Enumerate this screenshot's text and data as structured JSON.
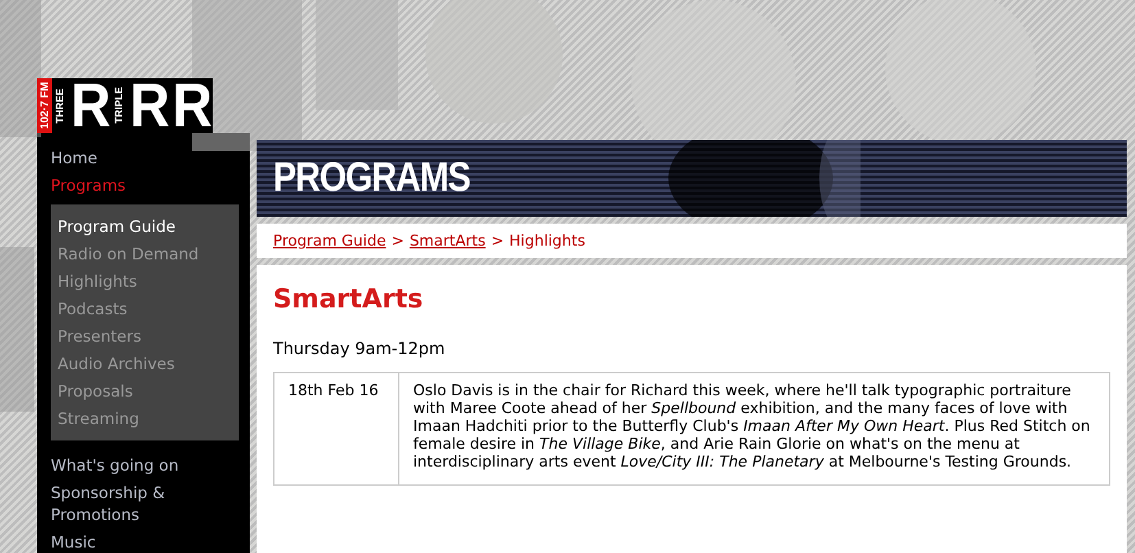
{
  "logo": {
    "frequency": "102·7 FM",
    "parts": [
      {
        "kind": "vertical",
        "text": "THREE"
      },
      {
        "kind": "letter",
        "text": "R"
      },
      {
        "kind": "vertical",
        "text": "TRIPLE"
      },
      {
        "kind": "letter",
        "text": "R"
      },
      {
        "kind": "letter",
        "text": "R"
      }
    ]
  },
  "nav": {
    "items": [
      {
        "label": "Home",
        "selected": false
      },
      {
        "label": "Programs",
        "selected": true,
        "children": [
          {
            "label": "Program Guide",
            "selected": true
          },
          {
            "label": "Radio on Demand",
            "selected": false
          },
          {
            "label": "Highlights",
            "selected": false
          },
          {
            "label": "Podcasts",
            "selected": false
          },
          {
            "label": "Presenters",
            "selected": false
          },
          {
            "label": "Audio Archives",
            "selected": false
          },
          {
            "label": "Proposals",
            "selected": false
          },
          {
            "label": "Streaming",
            "selected": false
          }
        ]
      },
      {
        "label": "What's going on",
        "selected": false
      },
      {
        "label": "Sponsorship & Promotions",
        "selected": false
      },
      {
        "label": "Music",
        "selected": false
      }
    ]
  },
  "banner": {
    "title": "PROGRAMS"
  },
  "breadcrumb": [
    {
      "label": "Program Guide",
      "kind": "link"
    },
    {
      "label": "SmartArts",
      "kind": "link"
    },
    {
      "label": "Highlights",
      "kind": "current"
    }
  ],
  "breadcrumb_separator": ">",
  "program": {
    "title": "SmartArts",
    "schedule": "Thursday 9am-12pm"
  },
  "highlights": [
    {
      "date": "18th Feb 16",
      "description": "Oslo Davis is in the chair for Richard this week, where he'll talk typographic portraiture with Maree Coote ahead of her *Spellbound* exhibition, and the many faces of love with Imaan Hadchiti prior to the Butterfly Club's *Imaan After My Own Heart*. Plus Red Stitch on female desire in *The Village Bike*, and Arie Rain Glorie on what's on the menu at interdisciplinary arts event *Love/City III: The Planetary* at Melbourne's Testing Grounds."
    }
  ]
}
